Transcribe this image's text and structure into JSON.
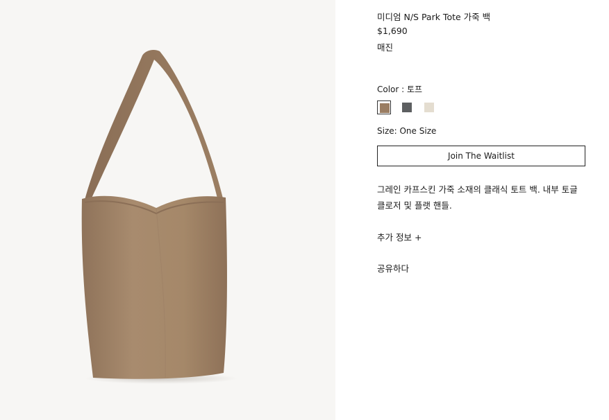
{
  "product": {
    "title": "미디엄 N/S Park Tote 가죽 백",
    "price": "$1,690",
    "availability": "매진",
    "color_label": "Color : 토프",
    "colors": [
      {
        "name": "taupe",
        "hex": "#9a7d62",
        "selected": true
      },
      {
        "name": "gray",
        "hex": "#5d5f61",
        "selected": false
      },
      {
        "name": "ivory",
        "hex": "#e4ddd0",
        "selected": false
      }
    ],
    "size_label": "Size: One Size",
    "waitlist_button": "Join The Waitlist",
    "description": "그레인 카프스킨 가죽 소재의 클래식 토트 백. 내부 토글 클로저 및 플랫 핸들.",
    "more_info": "추가 정보 +",
    "share": "공유하다"
  },
  "image": {
    "background": "#f7f6f4",
    "bag_color": "#a88b6e",
    "icon": "tote-bag-product-photo"
  }
}
